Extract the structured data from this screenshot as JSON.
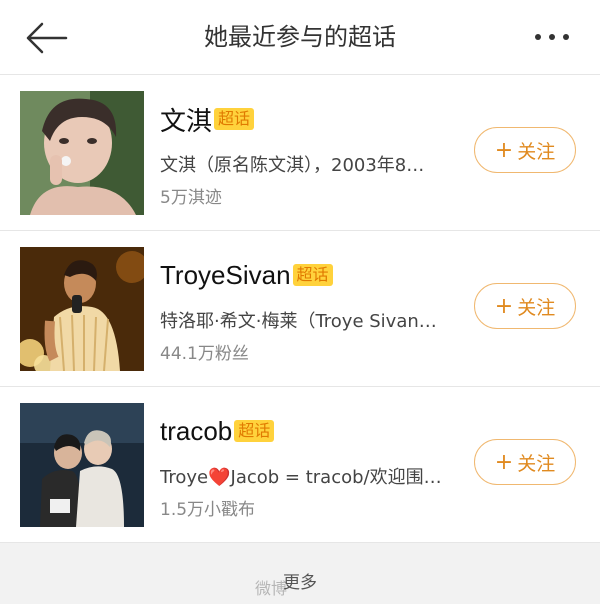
{
  "header": {
    "title": "她最近参与的超话"
  },
  "items": [
    {
      "name": "文淇",
      "badge": "超话",
      "desc": "文淇（原名陈文淇），2003年8…",
      "stat": "5万淇迹",
      "follow_label": "关注"
    },
    {
      "name": "TroyeSivan",
      "badge": "超话",
      "desc": "特洛耶·希文·梅莱（Troye Sivan…",
      "stat": "44.1万粉丝",
      "follow_label": "关注"
    },
    {
      "name": "tracob",
      "badge": "超话",
      "desc_pre": "Troye",
      "desc_heart": "❤️",
      "desc_post": "Jacob = tracob/欢迎围…",
      "stat": "1.5万小戳布",
      "follow_label": "关注"
    }
  ],
  "footer": {
    "more_label": "更多",
    "watermark": "微博"
  },
  "colors": {
    "badge_bg": "#ffd23c",
    "badge_text": "#e07a00",
    "follow_border": "#f0b870",
    "follow_text": "#e08a20"
  }
}
